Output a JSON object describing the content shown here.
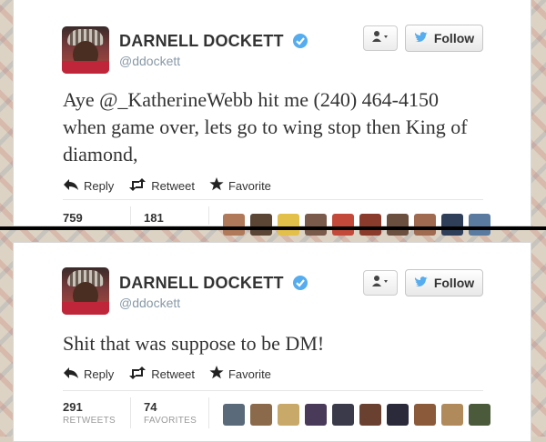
{
  "tweets": [
    {
      "author_name": "DARNELL DOCKETT",
      "handle": "@ddockett",
      "follow_label": "Follow",
      "text": "Aye @_KatherineWebb hit me (240) 464-4150 when game over, lets go to wing stop then King of diamond,",
      "actions": {
        "reply": "Reply",
        "retweet": "Retweet",
        "favorite": "Favorite"
      },
      "stats": {
        "retweets": "759",
        "favorites": "181"
      },
      "favoriter_avatar_colors": [
        "#b07a5a",
        "#5b4636",
        "#e3c04a",
        "#7a5a4a",
        "#c34a3a",
        "#8b3b2b",
        "#6b5040",
        "#a06a50",
        "#2f3f5a",
        "#5a7aa0"
      ]
    },
    {
      "author_name": "DARNELL DOCKETT",
      "handle": "@ddockett",
      "follow_label": "Follow",
      "text": "Shit that was suppose to be DM!",
      "actions": {
        "reply": "Reply",
        "retweet": "Retweet",
        "favorite": "Favorite"
      },
      "stats": {
        "retweets": "291",
        "retweets_label": "RETWEETS",
        "favorites": "74",
        "favorites_label": "FAVORITES"
      },
      "favoriter_avatar_colors": [
        "#5a6a7a",
        "#8a6a4a",
        "#c9a96a",
        "#4a3a5a",
        "#3a3a4a",
        "#6a4030",
        "#2a2a3a",
        "#8a5a3a",
        "#b08a5a",
        "#4a5a3a"
      ]
    }
  ],
  "colors": {
    "follow_bird": "#55acee",
    "verified": "#55acee",
    "text": "#333333",
    "divider": "#000000"
  },
  "icons": [
    "user-dropdown-icon",
    "twitter-bird-icon",
    "verified-badge-icon",
    "reply-arrow-icon",
    "retweet-icon",
    "favorite-star-icon"
  ]
}
